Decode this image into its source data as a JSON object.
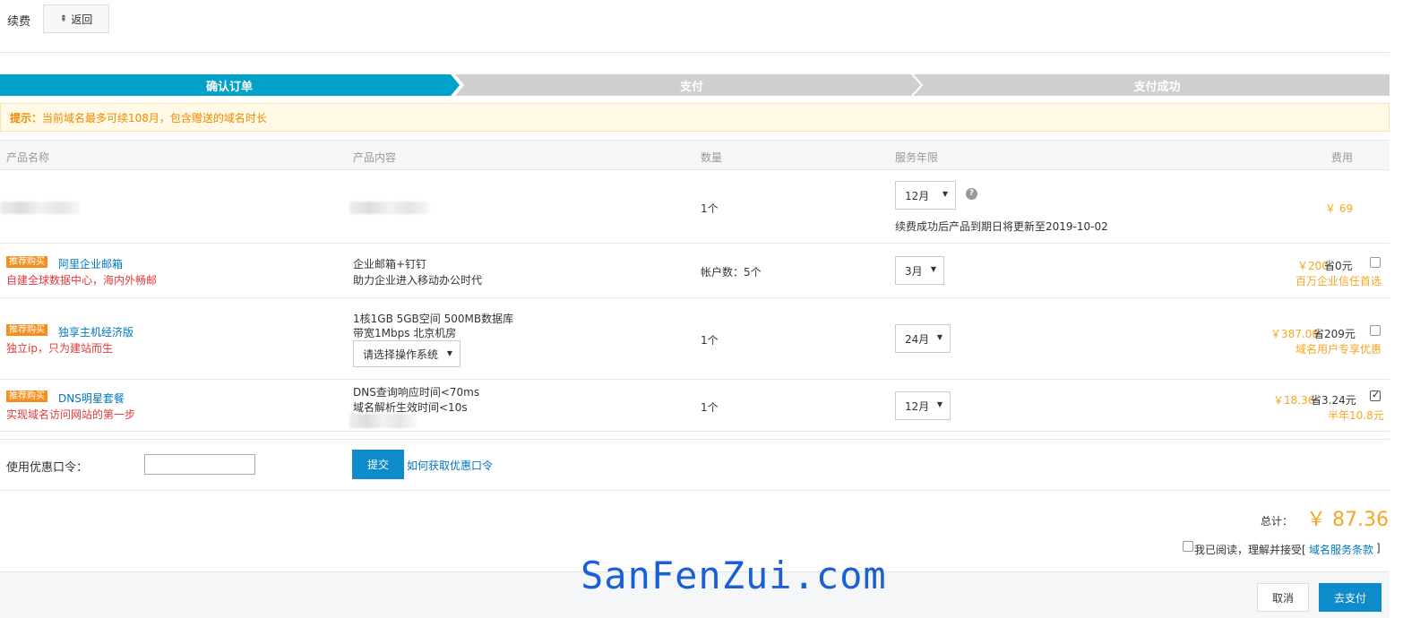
{
  "header": {
    "title": "续费",
    "back_label": "返回"
  },
  "steps": [
    {
      "label": "确认订单",
      "active": true
    },
    {
      "label": "支付",
      "active": false
    },
    {
      "label": "支付成功",
      "active": false
    }
  ],
  "notice": {
    "prefix": "提示：",
    "text": "当前域名最多可续108月，包含赠送的域名时长"
  },
  "table": {
    "headers": [
      "产品名称",
      "产品内容",
      "数量",
      "服务年限",
      "费用"
    ],
    "main_row": {
      "quantity": "1个",
      "period": "12月",
      "expire_note": "续费成功后产品到期日将更新至2019-10-02",
      "price": "￥ 69"
    },
    "promo_rows": [
      {
        "badge": "推荐购买",
        "name": "阿里企业邮箱",
        "subtitle": "自建全球数据中心，海内外畅邮",
        "content_line1": "企业邮箱+钉钉",
        "content_line2": "助力企业进入移动办公时代",
        "quantity": "帐户数：5个",
        "period": "3月",
        "price": "￥200",
        "saving": "省0元",
        "tagline": "百万企业信任首选",
        "checked": false
      },
      {
        "badge": "推荐购买",
        "name": "独享主机经济版",
        "subtitle": "独立ip，只为建站而生",
        "content_line1": "1核1GB 5GB空间 500MB数据库",
        "content_line2": "带宽1Mbps 北京机房",
        "os_select": "请选择操作系统",
        "quantity": "1个",
        "period": "24月",
        "price": "￥387.00",
        "saving": "省209元",
        "tagline": "域名用户专享优惠",
        "checked": false
      },
      {
        "badge": "推荐购买",
        "name": "DNS明星套餐",
        "subtitle": "实现域名访问网站的第一步",
        "content_line1": "DNS查询响应时间<70ms",
        "content_line2": "域名解析生效时间<10s",
        "quantity": "1个",
        "period": "12月",
        "price": "￥18.36",
        "saving": "省3.24元",
        "tagline": "半年10.8元",
        "checked": true
      }
    ]
  },
  "coupon": {
    "label": "使用优惠口令：",
    "value": "",
    "submit_label": "提交",
    "help_link": "如何获取优惠口令"
  },
  "summary": {
    "total_label": "总计：",
    "total_value": "￥ 87.36",
    "agree_text": "我已阅读，理解并接受[",
    "agree_link": "域名服务条款",
    "agree_close": "]"
  },
  "footer": {
    "cancel_label": "取消",
    "pay_label": "去支付"
  },
  "watermark": "SanFenZui.com",
  "colors": {
    "primary": "#0e8bca",
    "price": "#f5a623",
    "promo_red": "#e4393c",
    "step_inactive": "#cfcfcf"
  }
}
